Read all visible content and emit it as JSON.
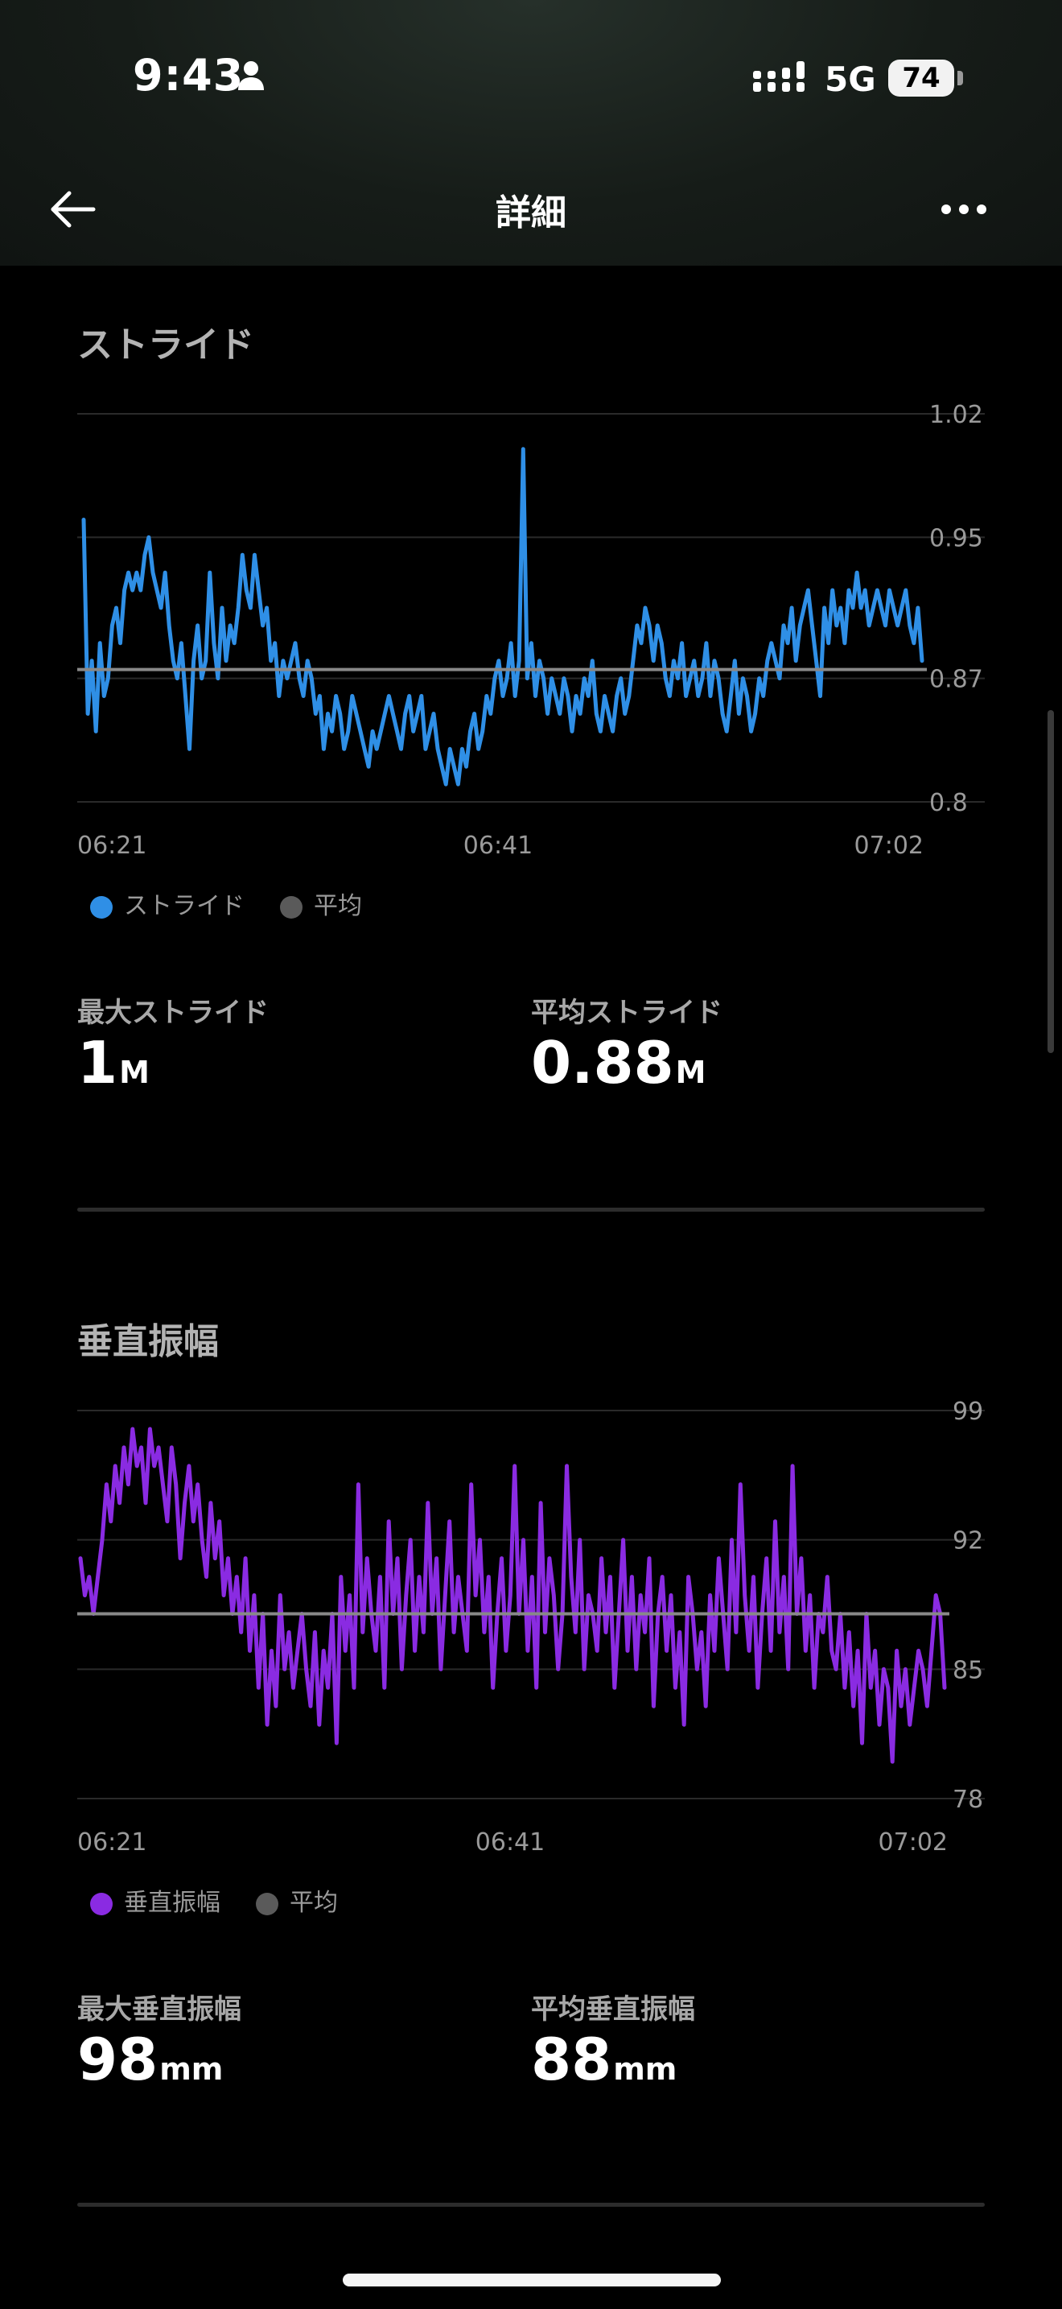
{
  "status_bar": {
    "time": "9:43",
    "network": "5G",
    "battery": "74",
    "icons": [
      "person-icon",
      "signal-icon",
      "battery-icon"
    ]
  },
  "header": {
    "title": "詳細",
    "back_icon": "arrow-left-icon",
    "more_icon": "ellipsis-icon"
  },
  "stride": {
    "title": "ストライド",
    "legend": {
      "series": "ストライド",
      "average": "平均"
    },
    "max_label": "最大ストライド",
    "max_value": "1",
    "max_unit": "M",
    "avg_label": "平均ストライド",
    "avg_value": "0.88",
    "avg_unit": "M"
  },
  "vertical": {
    "title": "垂直振幅",
    "legend": {
      "series": "垂直振幅",
      "average": "平均"
    },
    "max_label": "最大垂直振幅",
    "max_value": "98",
    "max_unit": "mm",
    "avg_label": "平均垂直振幅",
    "avg_value": "88",
    "avg_unit": "mm"
  },
  "colors": {
    "stride_line": "#2f8fe6",
    "vertical_line": "#8a2be2",
    "average_line": "#888888",
    "grid": "#2a2a2a",
    "tick_text": "#9a9a9a"
  },
  "chart_data": [
    {
      "type": "line",
      "title": "ストライド",
      "xlabel": "",
      "ylabel": "",
      "x_ticks": [
        "06:21",
        "06:41",
        "07:02"
      ],
      "y_ticks": [
        1.02,
        0.95,
        0.87,
        0.8
      ],
      "y_tick_labels": [
        "1.02",
        "0.95",
        "0.87",
        "0.8"
      ],
      "ylim": [
        0.8,
        1.02
      ],
      "grid": true,
      "legend_position": "bottom-left",
      "average": 0.875,
      "series": [
        {
          "name": "ストライド",
          "color": "#2f8fe6",
          "values": [
            0.96,
            0.85,
            0.88,
            0.84,
            0.89,
            0.86,
            0.87,
            0.9,
            0.91,
            0.89,
            0.92,
            0.93,
            0.92,
            0.93,
            0.92,
            0.94,
            0.95,
            0.93,
            0.92,
            0.91,
            0.93,
            0.9,
            0.88,
            0.87,
            0.89,
            0.86,
            0.83,
            0.88,
            0.9,
            0.87,
            0.88,
            0.93,
            0.89,
            0.87,
            0.91,
            0.88,
            0.9,
            0.89,
            0.91,
            0.94,
            0.92,
            0.91,
            0.94,
            0.92,
            0.9,
            0.91,
            0.88,
            0.89,
            0.86,
            0.88,
            0.87,
            0.88,
            0.89,
            0.87,
            0.86,
            0.88,
            0.87,
            0.85,
            0.86,
            0.83,
            0.85,
            0.84,
            0.86,
            0.85,
            0.83,
            0.84,
            0.86,
            0.85,
            0.84,
            0.83,
            0.82,
            0.84,
            0.83,
            0.84,
            0.85,
            0.86,
            0.85,
            0.84,
            0.83,
            0.85,
            0.86,
            0.84,
            0.85,
            0.86,
            0.83,
            0.84,
            0.85,
            0.83,
            0.82,
            0.81,
            0.83,
            0.82,
            0.81,
            0.83,
            0.82,
            0.84,
            0.85,
            0.83,
            0.84,
            0.86,
            0.85,
            0.87,
            0.88,
            0.86,
            0.87,
            0.89,
            0.86,
            0.88,
            1.0,
            0.87,
            0.89,
            0.86,
            0.88,
            0.87,
            0.85,
            0.87,
            0.86,
            0.85,
            0.87,
            0.86,
            0.84,
            0.86,
            0.85,
            0.87,
            0.86,
            0.88,
            0.85,
            0.84,
            0.86,
            0.85,
            0.84,
            0.86,
            0.87,
            0.85,
            0.86,
            0.88,
            0.9,
            0.89,
            0.91,
            0.9,
            0.88,
            0.9,
            0.89,
            0.87,
            0.86,
            0.88,
            0.87,
            0.89,
            0.86,
            0.87,
            0.88,
            0.86,
            0.87,
            0.89,
            0.86,
            0.88,
            0.87,
            0.85,
            0.84,
            0.86,
            0.88,
            0.85,
            0.87,
            0.86,
            0.84,
            0.85,
            0.87,
            0.86,
            0.88,
            0.89,
            0.88,
            0.87,
            0.9,
            0.89,
            0.91,
            0.88,
            0.9,
            0.91,
            0.92,
            0.9,
            0.88,
            0.86,
            0.91,
            0.89,
            0.92,
            0.9,
            0.91,
            0.89,
            0.92,
            0.91,
            0.93,
            0.91,
            0.92,
            0.9,
            0.91,
            0.92,
            0.91,
            0.9,
            0.92,
            0.91,
            0.9,
            0.91,
            0.92,
            0.9,
            0.89,
            0.91,
            0.88
          ]
        }
      ]
    },
    {
      "type": "line",
      "title": "垂直振幅",
      "xlabel": "",
      "ylabel": "",
      "x_ticks": [
        "06:21",
        "06:41",
        "07:02"
      ],
      "y_ticks": [
        99,
        92,
        85,
        78
      ],
      "y_tick_labels": [
        "99",
        "92",
        "85",
        "78"
      ],
      "ylim": [
        78,
        99
      ],
      "grid": true,
      "legend_position": "bottom-left",
      "average": 88,
      "series": [
        {
          "name": "垂直振幅",
          "color": "#8a2be2",
          "values": [
            91,
            89,
            90,
            88,
            90,
            92,
            95,
            93,
            96,
            94,
            97,
            95,
            98,
            96,
            97,
            94,
            98,
            96,
            97,
            95,
            93,
            97,
            95,
            91,
            94,
            96,
            93,
            95,
            92,
            90,
            94,
            91,
            93,
            89,
            91,
            88,
            90,
            87,
            91,
            86,
            89,
            84,
            88,
            82,
            86,
            83,
            89,
            85,
            87,
            84,
            86,
            88,
            85,
            83,
            87,
            82,
            86,
            84,
            88,
            81,
            90,
            86,
            89,
            84,
            95,
            87,
            91,
            88,
            86,
            90,
            84,
            93,
            88,
            91,
            85,
            89,
            92,
            86,
            90,
            87,
            94,
            88,
            91,
            85,
            89,
            93,
            87,
            90,
            88,
            86,
            95,
            89,
            92,
            87,
            90,
            84,
            88,
            91,
            86,
            89,
            96,
            88,
            92,
            86,
            90,
            84,
            94,
            87,
            91,
            89,
            85,
            88,
            96,
            90,
            87,
            92,
            85,
            89,
            88,
            86,
            91,
            87,
            90,
            84,
            88,
            92,
            86,
            90,
            85,
            89,
            87,
            91,
            83,
            88,
            90,
            86,
            89,
            84,
            87,
            82,
            90,
            88,
            85,
            87,
            83,
            89,
            86,
            91,
            88,
            85,
            92,
            87,
            95,
            89,
            86,
            90,
            84,
            88,
            91,
            86,
            93,
            87,
            90,
            85,
            96,
            88,
            91,
            86,
            89,
            84,
            88,
            87,
            90,
            86,
            85,
            88,
            84,
            87,
            83,
            86,
            81,
            88,
            84,
            86,
            82,
            85,
            84,
            80,
            86,
            83,
            85,
            82,
            84,
            86,
            85,
            83,
            86,
            89,
            88,
            84
          ]
        }
      ]
    }
  ]
}
